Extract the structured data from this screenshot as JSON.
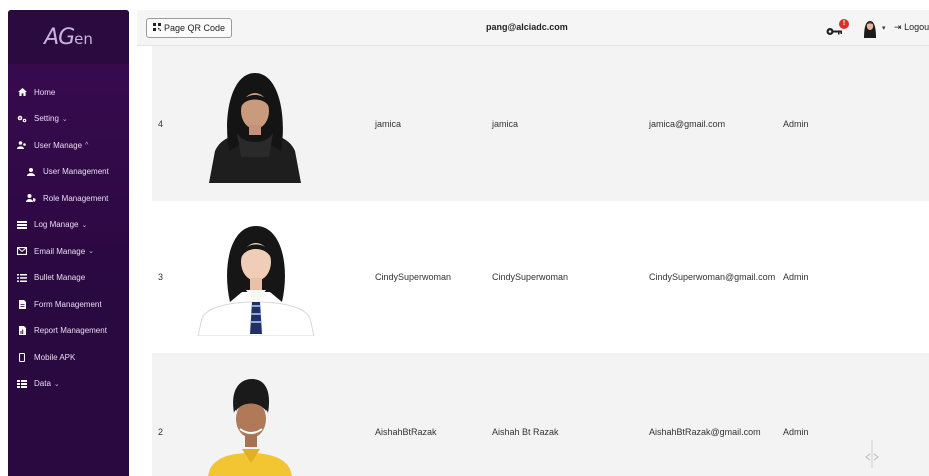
{
  "sidebar": {
    "logo": {
      "main": "AG",
      "sub": "en"
    },
    "items": [
      {
        "label": "Home",
        "icon": "home-icon",
        "caret": ""
      },
      {
        "label": "Setting",
        "icon": "cogs-icon",
        "caret": "⌄"
      },
      {
        "label": "User Manage",
        "icon": "users-icon",
        "caret": "^"
      },
      {
        "label": "User Management",
        "icon": "user-icon",
        "caret": "",
        "sub": true
      },
      {
        "label": "Role Management",
        "icon": "user-shield-icon",
        "caret": "",
        "sub": true
      },
      {
        "label": "Log Manage",
        "icon": "log-icon",
        "caret": "⌄"
      },
      {
        "label": "Email Manage",
        "icon": "envelope-icon",
        "caret": "⌄"
      },
      {
        "label": "Bullet Manage",
        "icon": "list-icon",
        "caret": ""
      },
      {
        "label": "Form Management",
        "icon": "file-icon",
        "caret": ""
      },
      {
        "label": "Report Management",
        "icon": "report-icon",
        "caret": ""
      },
      {
        "label": "Mobile APK",
        "icon": "mobile-icon",
        "caret": ""
      },
      {
        "label": "Data",
        "icon": "data-icon",
        "caret": "⌄"
      }
    ]
  },
  "header": {
    "qr_button": "Page QR Code",
    "email": "pang@alciadc.com",
    "notification_count": "!",
    "logout": "Logou"
  },
  "users": [
    {
      "id": "4",
      "username": "jamica",
      "name": "jamica",
      "email": "jamica@gmail.com",
      "role": "Admin"
    },
    {
      "id": "3",
      "username": "CindySuperwoman",
      "name": "CindySuperwoman",
      "email": "CindySuperwoman@gmail.com",
      "role": "Admin"
    },
    {
      "id": "2",
      "username": "AishahBtRazak",
      "name": "Aishah Bt Razak",
      "email": "AishahBtRazak@gmail.com",
      "role": "Admin"
    }
  ]
}
